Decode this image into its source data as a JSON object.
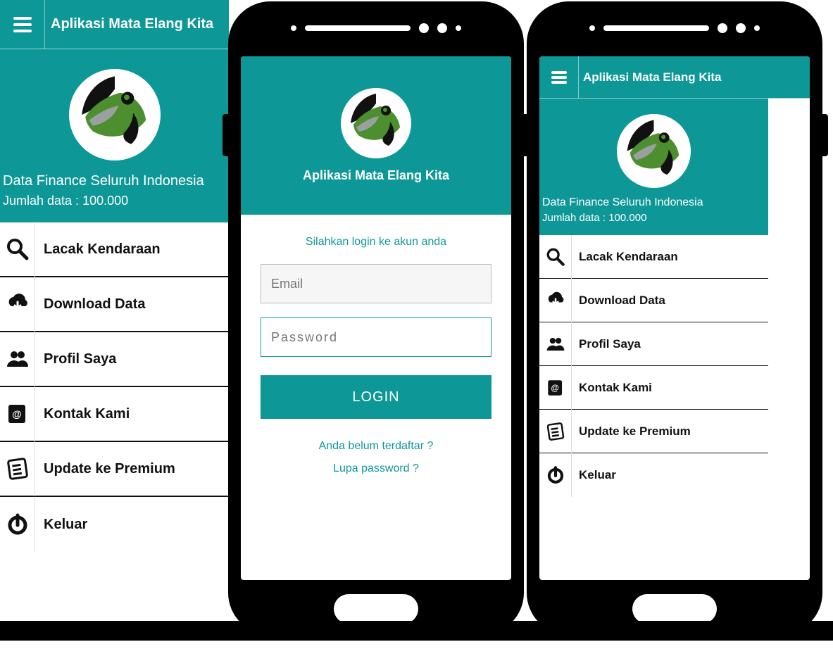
{
  "app": {
    "title": "Aplikasi Mata Elang Kita",
    "hero_line1": "Data Finance Seluruh Indonesia",
    "hero_line2": "Jumlah data : 100.000"
  },
  "menu": {
    "items": [
      {
        "label": "Lacak Kendaraan",
        "icon": "search-icon"
      },
      {
        "label": "Download Data",
        "icon": "cloud-download-icon"
      },
      {
        "label": "Profil Saya",
        "icon": "users-icon"
      },
      {
        "label": "Kontak Kami",
        "icon": "contact-card-icon"
      },
      {
        "label": "Update ke Premium",
        "icon": "checklist-icon"
      },
      {
        "label": "Keluar",
        "icon": "power-icon"
      }
    ]
  },
  "login": {
    "prompt": "Silahkan login ke akun anda",
    "email_placeholder": "Email",
    "password_placeholder": "Password",
    "button": "LOGIN",
    "register_link": "Anda belum terdaftar ?",
    "forgot_link": "Lupa password ?"
  },
  "colors": {
    "teal": "#0e9797",
    "text_dark": "#111111"
  }
}
